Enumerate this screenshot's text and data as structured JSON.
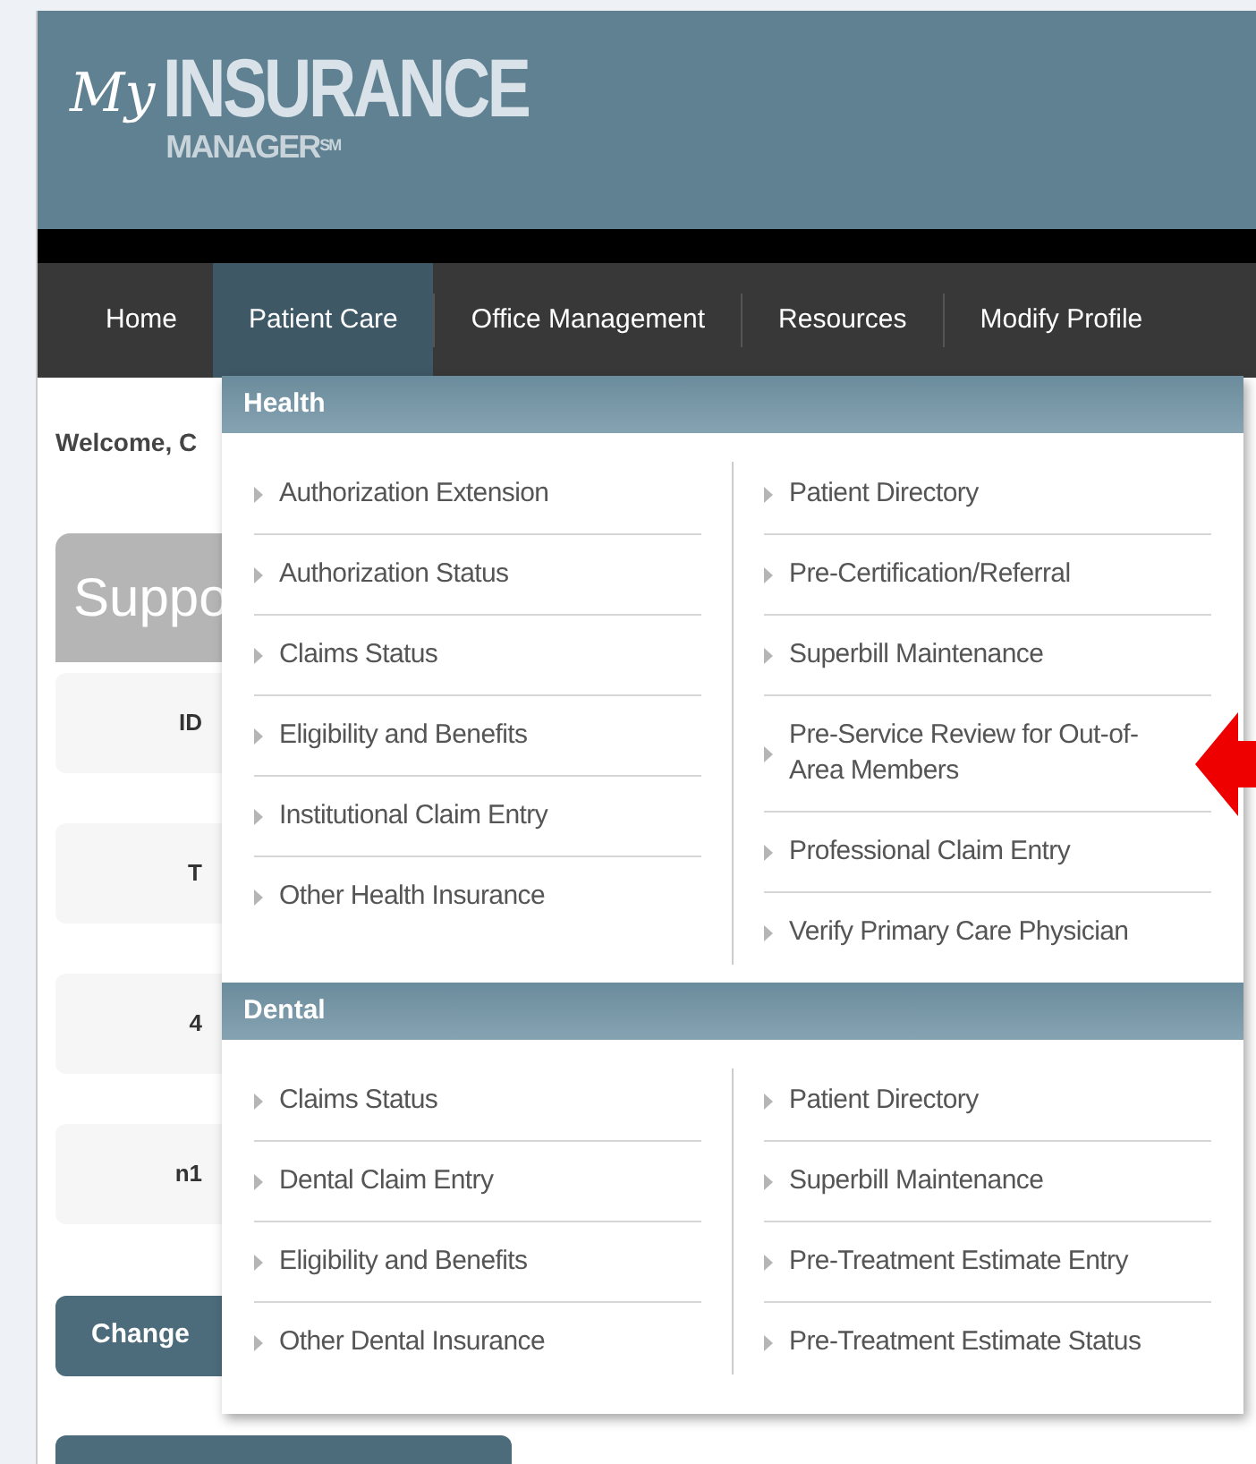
{
  "logo": {
    "script": "My",
    "main": "INSURANCE",
    "sub": "MANAGER",
    "mark": "SM"
  },
  "nav": [
    {
      "label": "Home",
      "selected": false
    },
    {
      "label": "Patient Care",
      "selected": true
    },
    {
      "label": "Office Management",
      "selected": false
    },
    {
      "label": "Resources",
      "selected": false
    },
    {
      "label": "Modify Profile",
      "selected": false
    }
  ],
  "page": {
    "welcome": "Welcome, C",
    "card_title": "Suppo",
    "fragments": [
      "ID",
      "T",
      "4",
      "n1"
    ],
    "button": "Change"
  },
  "menu": {
    "sections": [
      {
        "title": "Health",
        "columns": [
          [
            "Authorization Extension",
            "Authorization Status",
            "Claims Status",
            "Eligibility and Benefits",
            "Institutional Claim Entry",
            "Other Health Insurance"
          ],
          [
            "Patient Directory",
            "Pre-Certification/Referral",
            "Superbill Maintenance",
            "Pre-Service Review for Out-of-Area Members",
            "Professional Claim Entry",
            "Verify Primary Care Physician"
          ]
        ]
      },
      {
        "title": "Dental",
        "columns": [
          [
            "Claims Status",
            "Dental Claim Entry",
            "Eligibility and Benefits",
            "Other Dental Insurance"
          ],
          [
            "Patient Directory",
            "Superbill Maintenance",
            "Pre-Treatment Estimate Entry",
            "Pre-Treatment Estimate Status"
          ]
        ]
      }
    ]
  }
}
